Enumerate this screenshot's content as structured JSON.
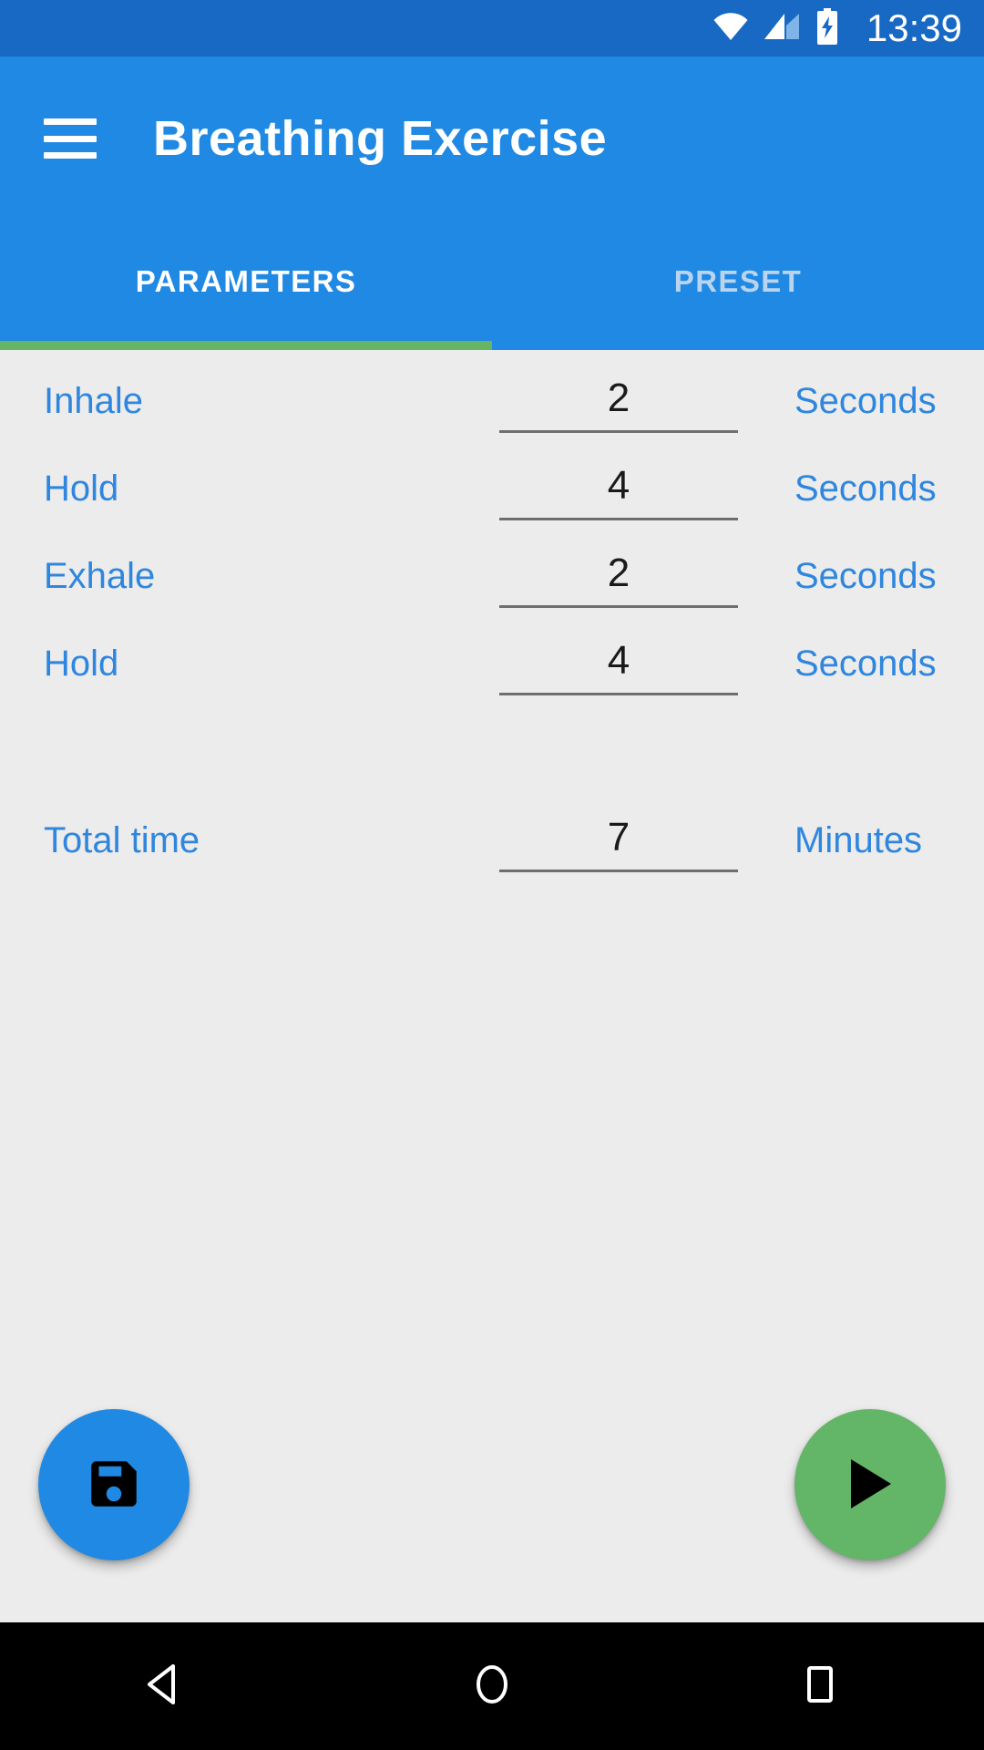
{
  "status_bar": {
    "time": "13:39",
    "wifi_icon": "wifi-icon",
    "signal_icon": "cellular-signal-icon",
    "battery_icon": "battery-charging-icon",
    "background_color": "#1769C4"
  },
  "app_bar": {
    "menu_icon": "hamburger-menu-icon",
    "title": "Breathing Exercise",
    "background_color": "#2089E3"
  },
  "tabs": {
    "items": [
      {
        "label": "PARAMETERS",
        "active": true
      },
      {
        "label": "PRESET",
        "active": false
      }
    ],
    "indicator_color": "#66B564",
    "active_text_color": "#FFFFFF",
    "inactive_text_color": "#B9D4EE"
  },
  "parameters": {
    "label_color": "#2F86DE",
    "value_color": "#1A1A1A",
    "rows": [
      {
        "label": "Inhale",
        "value": "2",
        "unit": "Seconds"
      },
      {
        "label": "Hold",
        "value": "4",
        "unit": "Seconds"
      },
      {
        "label": "Exhale",
        "value": "2",
        "unit": "Seconds"
      },
      {
        "label": "Hold",
        "value": "4",
        "unit": "Seconds"
      },
      {
        "label": "Total time",
        "value": "7",
        "unit": "Minutes"
      }
    ]
  },
  "actions": {
    "save": {
      "icon": "floppy-disk-save-icon",
      "color": "#2089E3"
    },
    "play": {
      "icon": "play-triangle-icon",
      "color": "#63B567"
    }
  },
  "nav_bar": {
    "back_icon": "back-triangle-icon",
    "home_icon": "home-circle-icon",
    "recents_icon": "recents-square-icon",
    "background_color": "#000000"
  }
}
